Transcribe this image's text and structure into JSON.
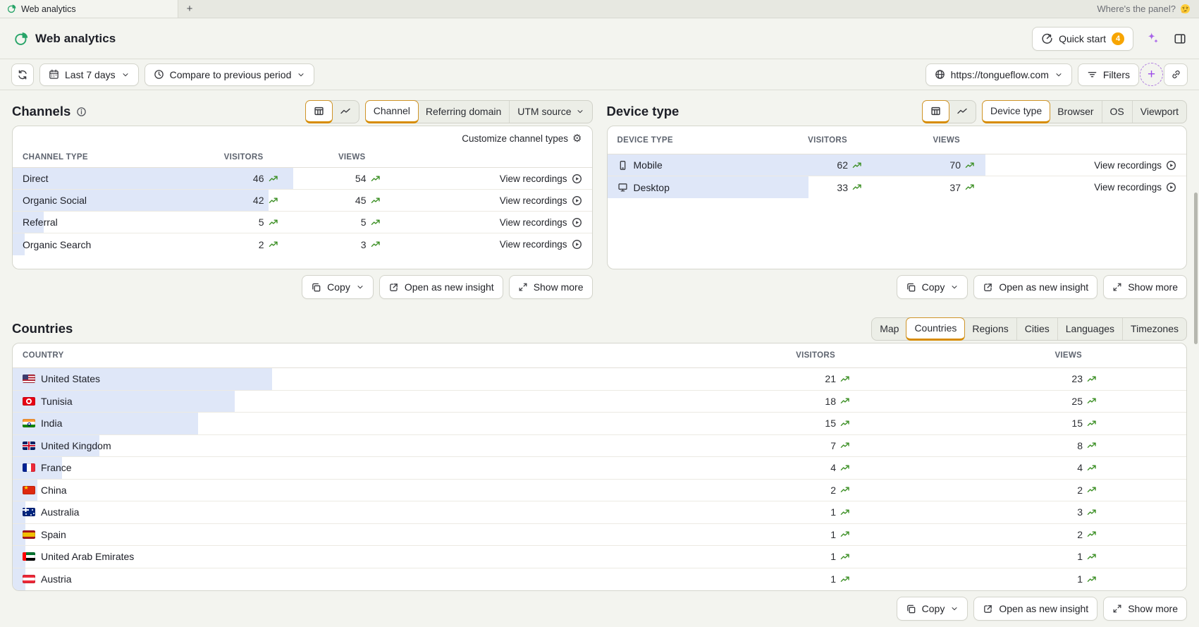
{
  "topbar": {
    "tab_title": "Web analytics",
    "new_tab_label": "+",
    "right_text": "Where's the panel?",
    "right_emoji": "🤔"
  },
  "header": {
    "title": "Web analytics",
    "quick_start_label": "Quick start",
    "quick_start_badge": "4"
  },
  "filter_bar": {
    "date_range_label": "Last 7 days",
    "compare_label": "Compare to previous period",
    "domain_label": "https://tongueflow.com",
    "filters_label": "Filters",
    "add_label": "+"
  },
  "card_footer": {
    "copy_label": "Copy",
    "open_label": "Open as new insight",
    "show_more_label": "Show more"
  },
  "channels": {
    "title": "Channels",
    "tabs": {
      "0": "Channel",
      "1": "Referring domain",
      "2": "UTM source"
    },
    "customize_label": "Customize channel types",
    "columns": {
      "label": "CHANNEL TYPE",
      "visitors": "VISITORS",
      "views": "VIEWS"
    },
    "rows": [
      {
        "label": "Direct",
        "visitors": "46",
        "views": "54",
        "bar_pct": 48.4,
        "recordings_label": "View recordings"
      },
      {
        "label": "Organic Social",
        "visitors": "42",
        "views": "45",
        "bar_pct": 44.2,
        "recordings_label": "View recordings"
      },
      {
        "label": "Referral",
        "visitors": "5",
        "views": "5",
        "bar_pct": 5.3,
        "recordings_label": "View recordings"
      },
      {
        "label": "Organic Search",
        "visitors": "2",
        "views": "3",
        "bar_pct": 2.1,
        "recordings_label": "View recordings"
      }
    ]
  },
  "device": {
    "title": "Device type",
    "tabs": {
      "0": "Device type",
      "1": "Browser",
      "2": "OS",
      "3": "Viewport"
    },
    "columns": {
      "label": "DEVICE TYPE",
      "visitors": "VISITORS",
      "views": "VIEWS"
    },
    "rows": [
      {
        "label": "Mobile",
        "visitors": "62",
        "views": "70",
        "bar_pct": 65.3,
        "recordings_label": "View recordings"
      },
      {
        "label": "Desktop",
        "visitors": "33",
        "views": "37",
        "bar_pct": 34.7,
        "recordings_label": "View recordings"
      }
    ]
  },
  "countries": {
    "title": "Countries",
    "tabs": {
      "0": "Map",
      "1": "Countries",
      "2": "Regions",
      "3": "Cities",
      "4": "Languages",
      "5": "Timezones"
    },
    "columns": {
      "label": "COUNTRY",
      "visitors": "VISITORS",
      "views": "VIEWS"
    },
    "rows": [
      {
        "label": "United States",
        "flag": "us",
        "visitors": "21",
        "views": "23",
        "bar_pct": 22.1
      },
      {
        "label": "Tunisia",
        "flag": "tn",
        "visitors": "18",
        "views": "25",
        "bar_pct": 18.9
      },
      {
        "label": "India",
        "flag": "in",
        "visitors": "15",
        "views": "15",
        "bar_pct": 15.8
      },
      {
        "label": "United Kingdom",
        "flag": "gb",
        "visitors": "7",
        "views": "8",
        "bar_pct": 7.4
      },
      {
        "label": "France",
        "flag": "fr",
        "visitors": "4",
        "views": "4",
        "bar_pct": 4.2
      },
      {
        "label": "China",
        "flag": "cn",
        "visitors": "2",
        "views": "2",
        "bar_pct": 2.1
      },
      {
        "label": "Australia",
        "flag": "au",
        "visitors": "1",
        "views": "3",
        "bar_pct": 1.1
      },
      {
        "label": "Spain",
        "flag": "es",
        "visitors": "1",
        "views": "2",
        "bar_pct": 1.1
      },
      {
        "label": "United Arab Emirates",
        "flag": "ae",
        "visitors": "1",
        "views": "1",
        "bar_pct": 1.1
      },
      {
        "label": "Austria",
        "flag": "at",
        "visitors": "1",
        "views": "1",
        "bar_pct": 1.1
      }
    ]
  },
  "colors": {
    "accent_orange": "#d78c00",
    "badge_orange": "#f7a501",
    "bar_blue": "#dfe7f8",
    "trend_green": "#3b8f24",
    "ai_purple": "#9d4be8",
    "brand_green": "#27a468",
    "page_bg": "#f3f4ef"
  }
}
